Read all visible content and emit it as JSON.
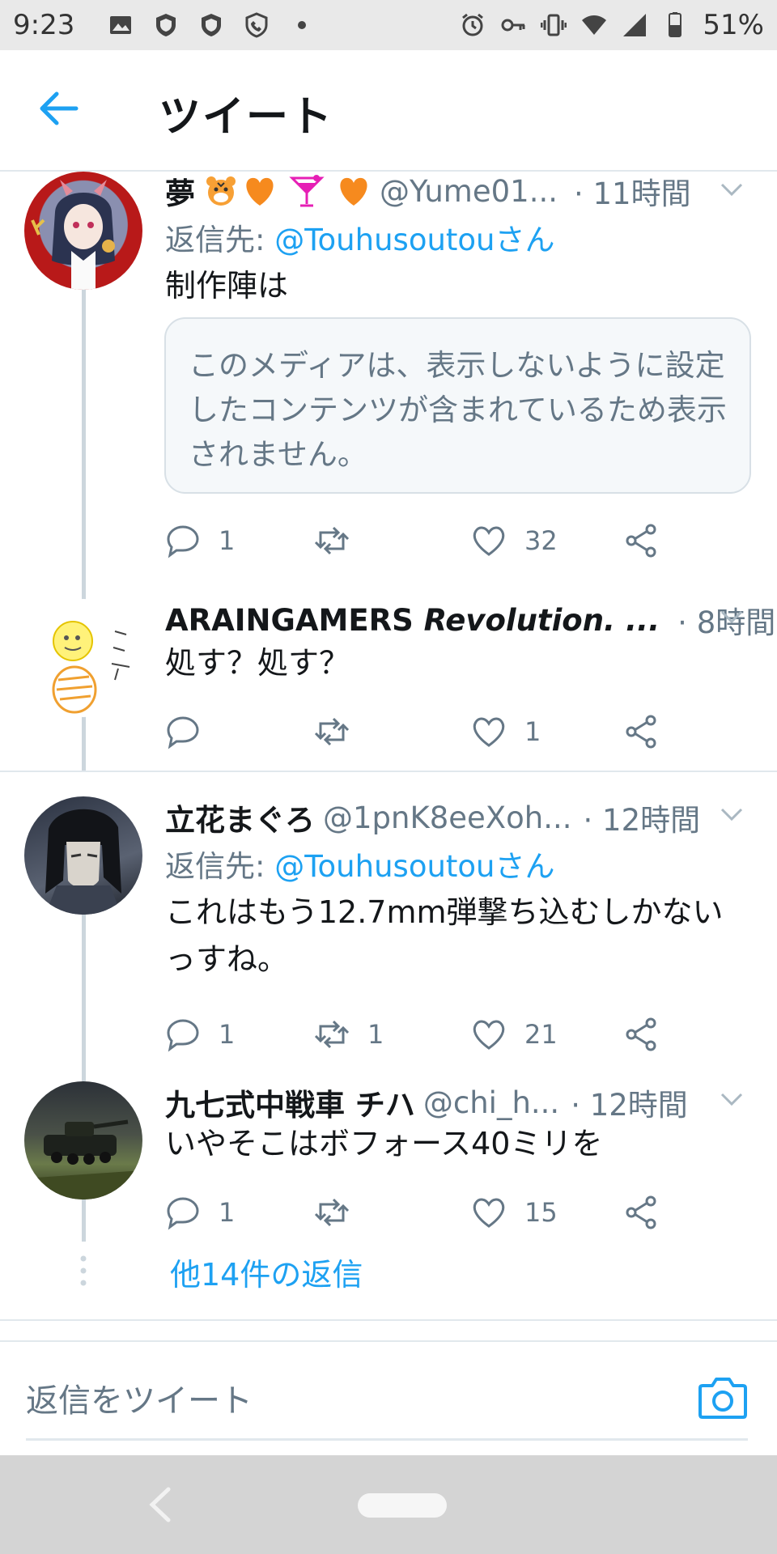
{
  "status_bar": {
    "time": "9:23",
    "battery": "51%"
  },
  "header": {
    "title": "ツイート"
  },
  "tweets": [
    {
      "name": "夢",
      "handle": "@Yume01...",
      "time": "· 11時間",
      "reply_label": "返信先:",
      "reply_mention": "@Touhusoutouさん",
      "text": "制作陣は",
      "media_notice": "このメディアは、表示しないように設定したコンテンツが含まれているため表示されません。",
      "replies": "1",
      "retweets": "",
      "likes": "32"
    },
    {
      "name": "ARAINGAMERS",
      "name_italic": "Revolution. ...",
      "handle": "",
      "time": "· 8時間",
      "text": "処す？処す？",
      "replies": "",
      "retweets": "",
      "likes": "1"
    },
    {
      "name": "立花まぐろ",
      "handle": "@1pnK8eeXoh...",
      "time": "· 12時間",
      "reply_label": "返信先:",
      "reply_mention": "@Touhusoutouさん",
      "text": "これはもう12.7mm弾撃ち込むしかないっすね。",
      "replies": "1",
      "retweets": "1",
      "likes": "21"
    },
    {
      "name": "九七式中戦車 チハ",
      "handle": "@chi_h...",
      "time": "· 12時間",
      "text": "いやそこはボフォース40ミリを",
      "replies": "1",
      "retweets": "",
      "likes": "15"
    }
  ],
  "more_replies": "他14件の返信",
  "compose": {
    "placeholder": "返信をツイート"
  },
  "colors": {
    "accent": "#1da1f2",
    "secondary_text": "#657786",
    "divider": "#e1e8ed"
  }
}
